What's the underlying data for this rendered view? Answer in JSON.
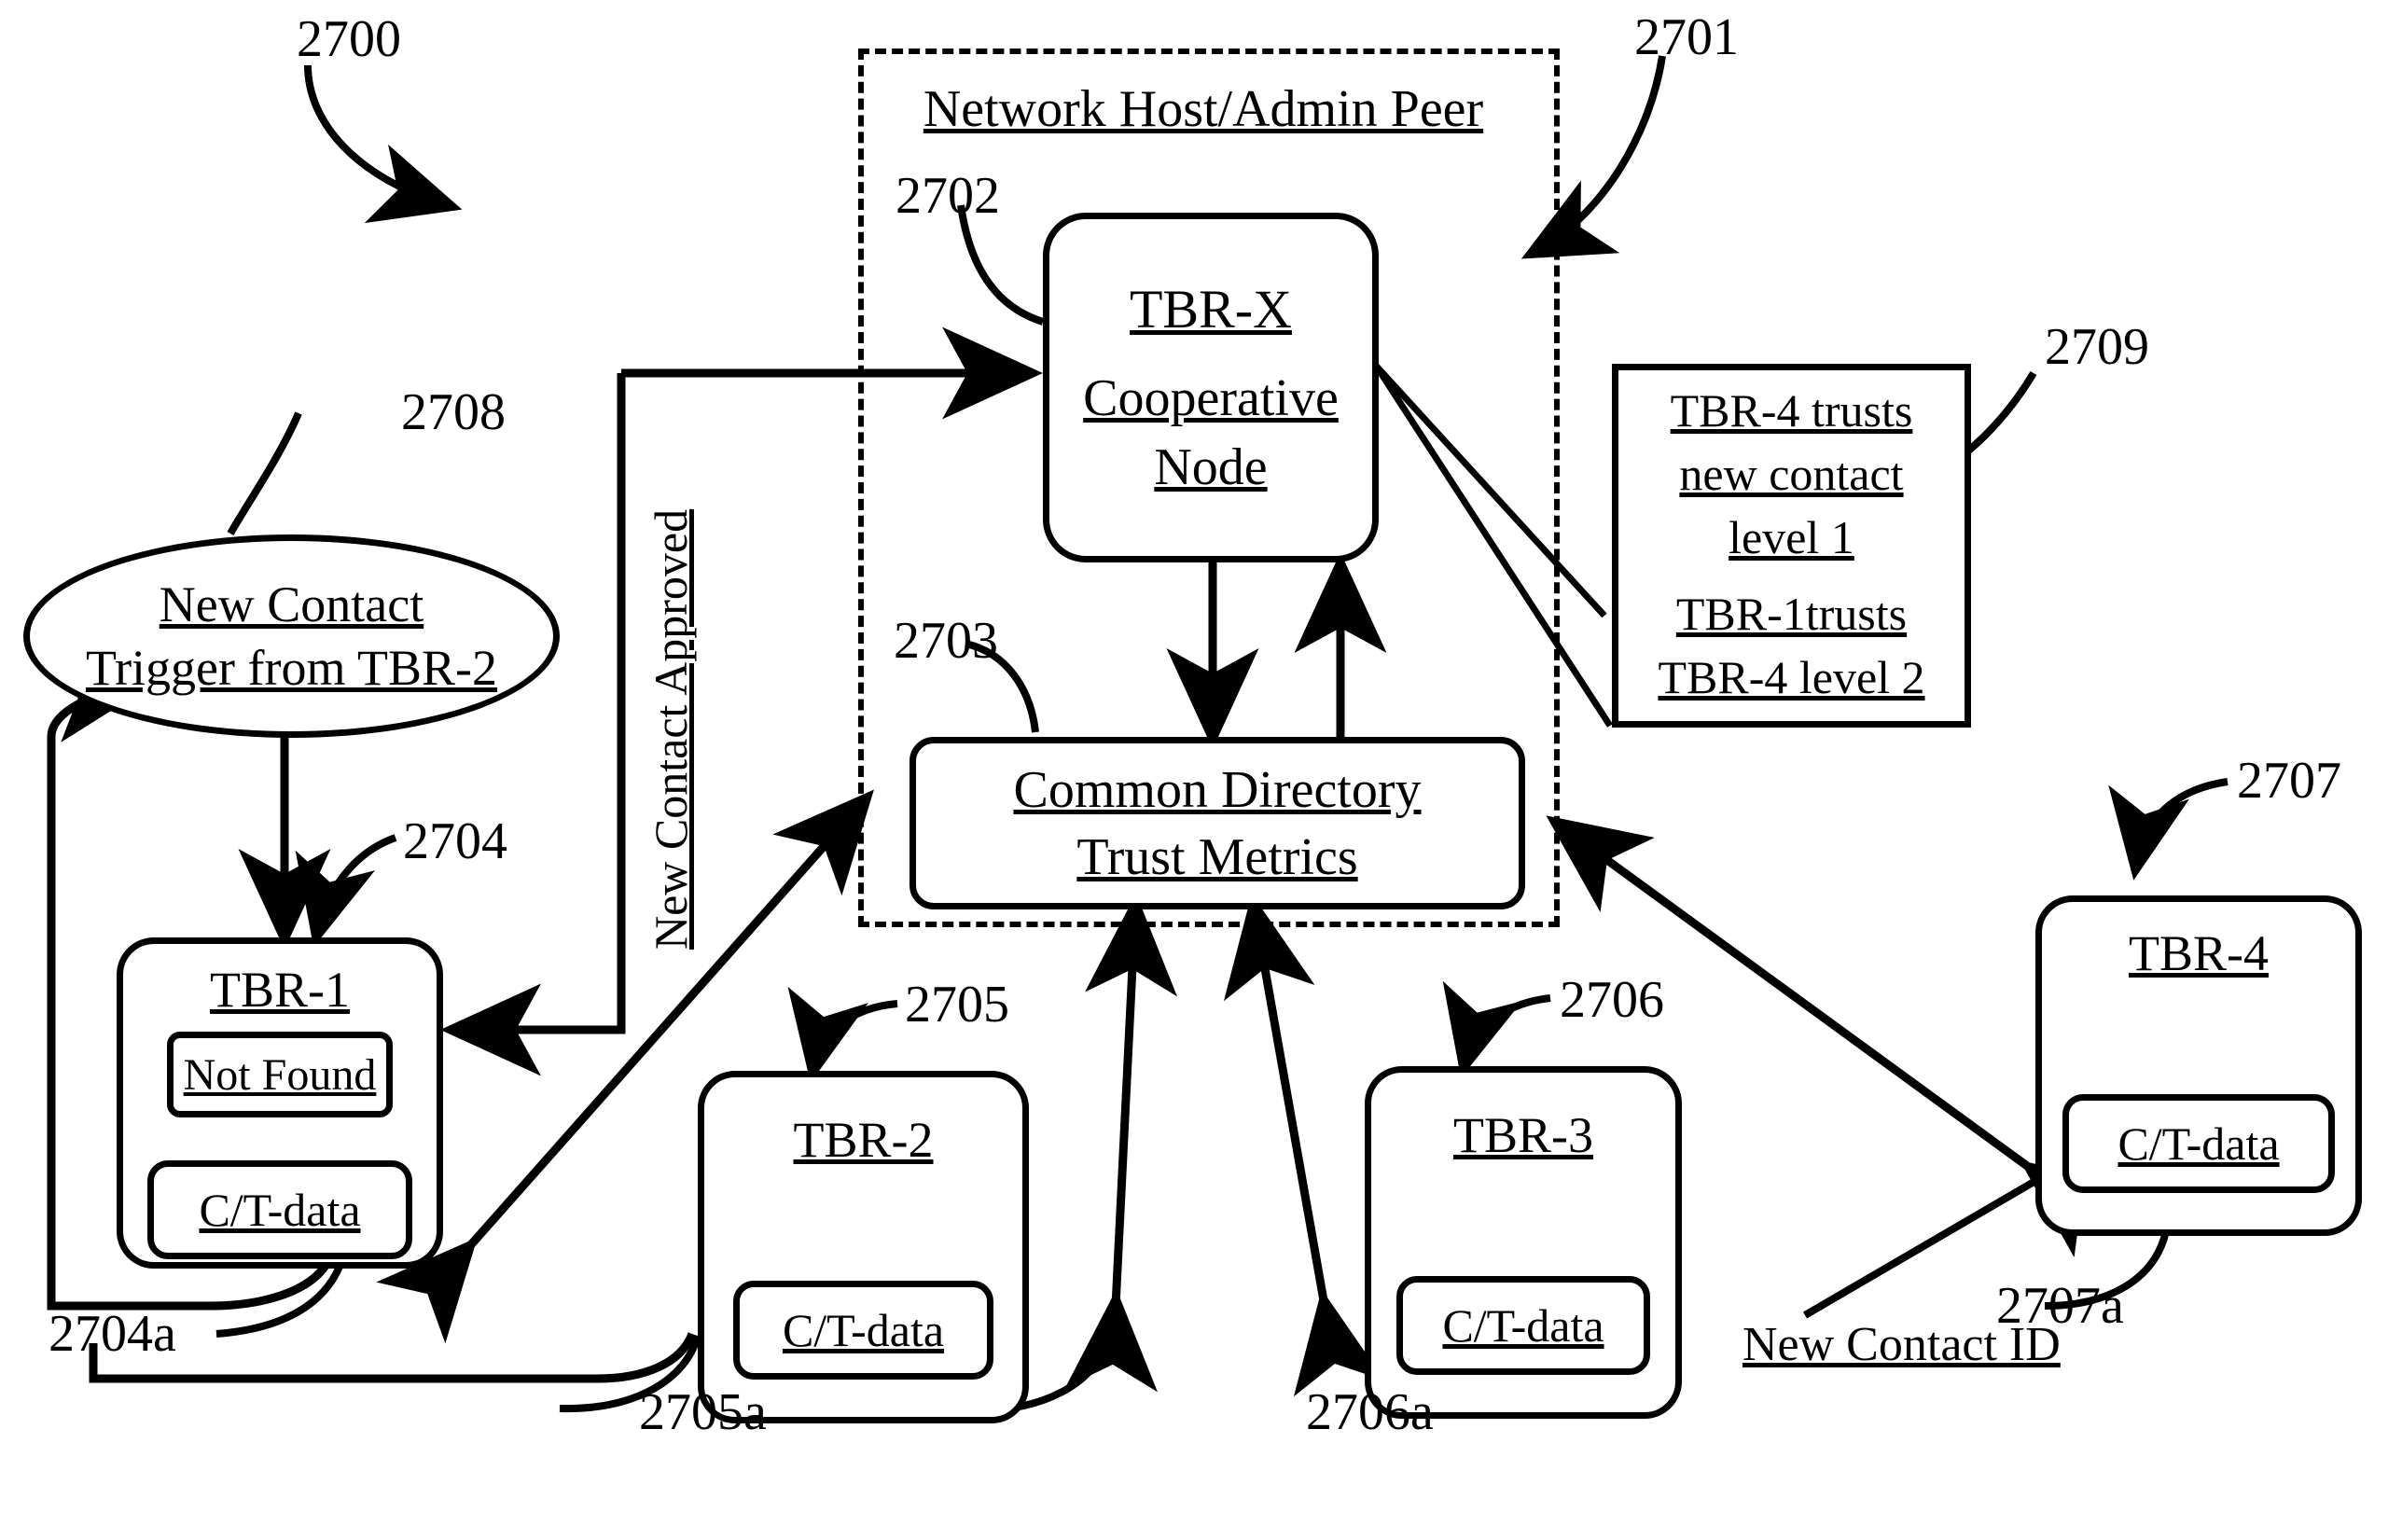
{
  "figure": {
    "ref_main": "2700",
    "container": {
      "ref": "2701",
      "title": "Network Host/Admin Peer"
    }
  },
  "nodes": {
    "tbrx": {
      "ref": "2702",
      "line1": "TBR-X",
      "line2": "Cooperative",
      "line3": "Node"
    },
    "directory": {
      "ref": "2703",
      "line1": "Common Directory",
      "line2": "Trust Metrics"
    },
    "tbr1": {
      "ref": "2704",
      "title": "TBR-1",
      "status": "Not Found",
      "data_ref": "2704a",
      "data_label": "C/T-data"
    },
    "tbr2": {
      "ref": "2705",
      "title": "TBR-2",
      "data_ref": "2705a",
      "data_label": "C/T-data"
    },
    "tbr3": {
      "ref": "2706",
      "title": "TBR-3",
      "data_ref": "2706a",
      "data_label": "C/T-data"
    },
    "tbr4": {
      "ref": "2707",
      "title": "TBR-4",
      "data_ref": "2707a",
      "data_label": "C/T-data",
      "new_contact_id": "New Contact ID"
    },
    "trigger": {
      "ref": "2708",
      "line1": "New Contact",
      "line2": "Trigger from TBR-2"
    },
    "trust_note": {
      "ref": "2709",
      "line1": "TBR-4 trusts",
      "line2": "new contact",
      "line3": "level 1",
      "line4": "TBR-1trusts",
      "line5": "TBR-4 level 2"
    }
  },
  "edges": {
    "approved_label": "New Contact Approved"
  },
  "colors": {
    "ink": "#000000",
    "paper": "#ffffff"
  }
}
